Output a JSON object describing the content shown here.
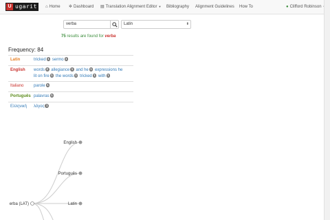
{
  "nav": {
    "logo_text": "ugarit",
    "logo_mark": "U",
    "items": [
      {
        "icon": "home-icon",
        "label": "Home"
      },
      {
        "icon": "dashboard-icon",
        "label": "Dashboard"
      },
      {
        "icon": "editor-icon",
        "label": "Translation Alignment Editor",
        "dropdown": true
      },
      {
        "label": "Bibliography"
      },
      {
        "label": "Alignment Guidelines"
      },
      {
        "label": "How To"
      }
    ],
    "user": {
      "icon": "user-icon",
      "label": "Clifford Robinson"
    }
  },
  "search": {
    "value": "verba",
    "language": "Latin"
  },
  "results": {
    "count": "75",
    "text": "results are found for",
    "term": "verba"
  },
  "frequency": "Frequency: 84",
  "table": [
    {
      "lang": "Latin",
      "color": "#e67e22",
      "words": [
        {
          "w": "tricked",
          "n": "1"
        },
        {
          "w": "sermo",
          "n": "1"
        }
      ]
    },
    {
      "lang": "English",
      "color": "#c9302c",
      "words": [
        {
          "w": "words",
          "n": "2"
        },
        {
          "w": "allegiance",
          "n": "1"
        },
        {
          "w": "and he",
          "n": "1"
        },
        {
          "w": "expressions",
          "n": "1"
        },
        {
          "w": "he",
          "n": ""
        },
        {
          "w": "lit on fire",
          "n": "1"
        },
        {
          "w": "the words",
          "n": "1"
        },
        {
          "w": "tricked",
          "n": "1"
        },
        {
          "w": "with",
          "n": "1"
        }
      ]
    },
    {
      "lang": "Italiano",
      "color": "#c9302c",
      "words": [
        {
          "w": "parole",
          "n": "1"
        }
      ]
    },
    {
      "lang": "Português",
      "color": "#5a8a1a",
      "words": [
        {
          "w": "palavras",
          "n": "1"
        }
      ]
    },
    {
      "lang": "Ελληνική",
      "color": "#337ab7",
      "words": [
        {
          "w": "λόγος",
          "n": "1"
        }
      ]
    }
  ],
  "tree": {
    "root": "erba (LAT)",
    "leaves": [
      "English",
      "Português",
      "Latin"
    ]
  }
}
